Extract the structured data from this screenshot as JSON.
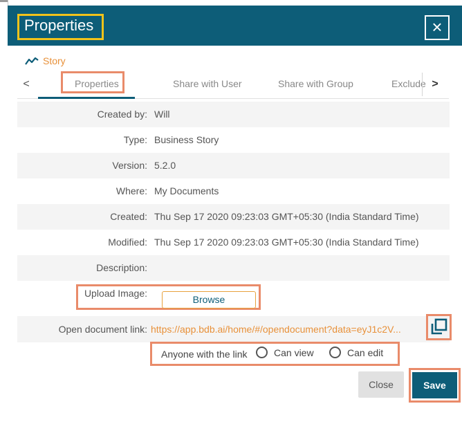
{
  "dialog": {
    "title": "Properties",
    "close_symbol": "×",
    "accent_color": "#0d5d78",
    "highlight_color": "#e98b6a"
  },
  "story": {
    "label": "Story",
    "icon": "line-chart-icon"
  },
  "tabs": {
    "prev_symbol": "<",
    "next_symbol": ">",
    "items": [
      {
        "label": "Properties",
        "active": true
      },
      {
        "label": "Share with User"
      },
      {
        "label": "Share with Group"
      },
      {
        "label": "Exclude"
      }
    ]
  },
  "properties": [
    {
      "label": "Created by:",
      "value": "Will"
    },
    {
      "label": "Type:",
      "value": "Business Story"
    },
    {
      "label": "Version:",
      "value": "5.2.0"
    },
    {
      "label": "Where:",
      "value": "My Documents"
    },
    {
      "label": "Created:",
      "value": "Thu Sep 17 2020 09:23:03 GMT+05:30 (India Standard Time)"
    },
    {
      "label": "Modified:",
      "value": "Thu Sep 17 2020 09:23:03 GMT+05:30 (India Standard Time)"
    },
    {
      "label": "Description:",
      "value": ""
    },
    {
      "label": "Upload Image:",
      "value": ""
    }
  ],
  "upload": {
    "button_label": "Browse"
  },
  "document_link": {
    "label": "Open document link:",
    "url": "https://app.bdb.ai/home/#/opendocument?data=eyJ1c2V...",
    "copy_icon": "copy-icon"
  },
  "permissions": {
    "prefix": "Anyone with the link",
    "options": [
      "Can view",
      "Can edit"
    ]
  },
  "footer": {
    "close_label": "Close",
    "save_label": "Save"
  }
}
